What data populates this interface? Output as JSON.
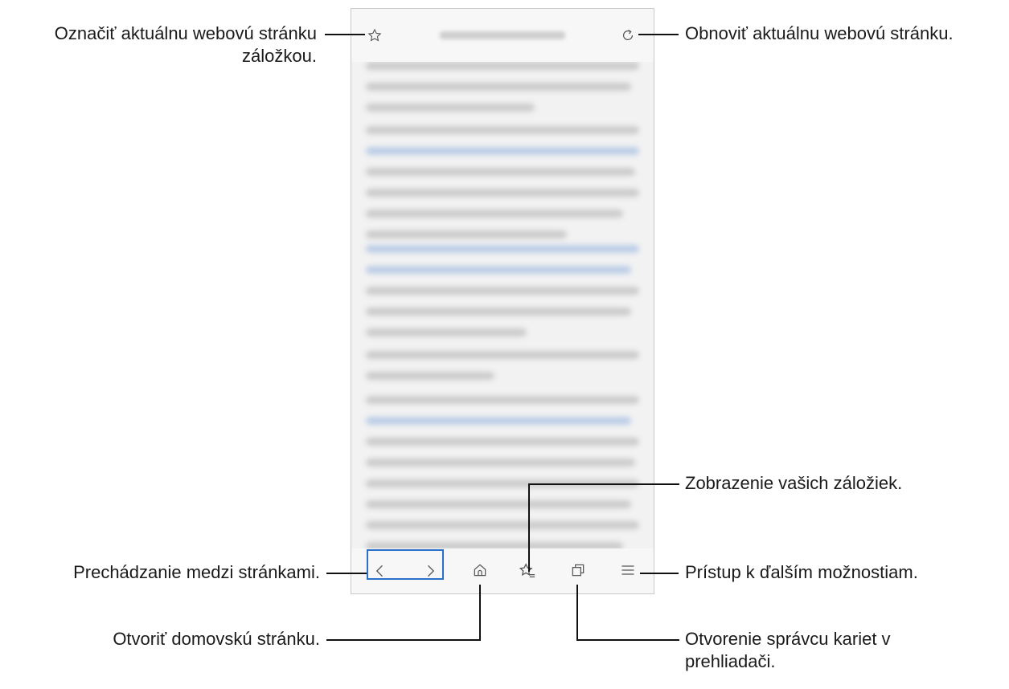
{
  "callouts": {
    "bookmark_line1": "Označiť aktuálnu webovú stránku",
    "bookmark_line2": "záložkou.",
    "refresh": "Obnoviť aktuálnu webovú stránku.",
    "bookmarks_view": "Zobrazenie vašich záložiek.",
    "navigate": "Prechádzanie medzi stránkami.",
    "more_options": "Prístup k ďalším možnostiam.",
    "home": "Otvoriť domovskú stránku.",
    "tabs_line1": "Otvorenie správcu kariet v",
    "tabs_line2": "prehliadači."
  },
  "icons": {
    "bookmark": "star-outline-icon",
    "refresh": "refresh-icon",
    "back": "chevron-left-icon",
    "forward": "chevron-right-icon",
    "home": "home-icon",
    "bookmarks": "star-list-icon",
    "tabs": "tabs-icon",
    "menu": "hamburger-menu-icon"
  },
  "colors": {
    "highlight": "#2a6fc9",
    "callout_line": "#111111"
  }
}
